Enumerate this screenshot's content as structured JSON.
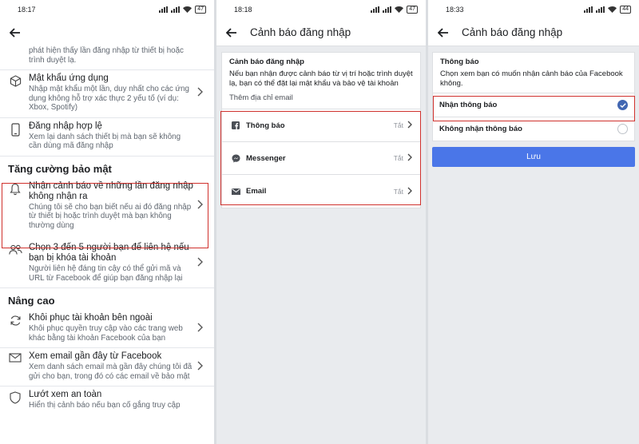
{
  "panel1": {
    "status": {
      "time": "18:17",
      "battery": "47"
    },
    "items_top": [
      {
        "title": "",
        "desc": "phát hiện thấy lần đăng nhập từ thiết bị hoặc trình duyệt lạ."
      },
      {
        "icon": "cube-icon",
        "title": "Mật khẩu ứng dụng",
        "desc": "Nhập mật khẩu một lần, duy nhất cho các ứng dụng không hỗ trợ xác thực 2 yếu tố (ví dụ: Xbox, Spotify)"
      },
      {
        "icon": "phone-icon",
        "title": "Đăng nhập hợp lệ",
        "desc": "Xem lại danh sách thiết bị mà bạn sẽ không cần dùng mã đăng nhập"
      }
    ],
    "section_security": "Tăng cường bảo mật",
    "items_security": [
      {
        "icon": "bell-icon",
        "title": "Nhận cảnh báo về những lần đăng nhập không nhận ra",
        "desc": "Chúng tôi sẽ cho bạn biết nếu ai đó đăng nhập từ thiết bị hoặc trình duyệt mà bạn không thường dùng"
      },
      {
        "icon": "friends-icon",
        "title": "Chọn 3 đến 5 người bạn để liên hệ nếu bạn bị khóa tài khoản",
        "desc": "Người liên hệ đáng tin cậy có thể gửi mã và URL từ Facebook để giúp bạn đăng nhập lại"
      }
    ],
    "section_advanced": "Nâng cao",
    "items_advanced": [
      {
        "icon": "refresh-icon",
        "title": "Khôi phục tài khoản bên ngoài",
        "desc": "Khôi phục quyền truy cập vào các trang web khác bằng tài khoản Facebook của bạn"
      },
      {
        "icon": "email-icon",
        "title": "Xem email gần đây từ Facebook",
        "desc": "Xem danh sách email mà gần đây chúng tôi đã gửi cho bạn, trong đó có các email về bảo mật"
      },
      {
        "icon": "shield-icon",
        "title": "Lướt xem an toàn",
        "desc": "Hiển thị cảnh báo nếu bạn cố gắng truy cập"
      }
    ]
  },
  "panel2": {
    "status": {
      "time": "18:18",
      "battery": "47"
    },
    "title": "Cảnh báo đăng nhập",
    "card_title": "Cảnh báo đăng nhập",
    "card_desc": "Nếu bạn nhận được cảnh báo từ vị trí hoặc trình duyệt lạ, bạn có thể đặt lại mật khẩu và bảo vệ tài khoản",
    "card_link": "Thêm địa chỉ email",
    "rows": [
      {
        "icon": "facebook-icon",
        "label": "Thông báo",
        "value": "Tắt"
      },
      {
        "icon": "messenger-icon",
        "label": "Messenger",
        "value": "Tắt"
      },
      {
        "icon": "envelope-icon",
        "label": "Email",
        "value": "Tắt"
      }
    ]
  },
  "panel3": {
    "status": {
      "time": "18:33",
      "battery": "44"
    },
    "title": "Cảnh báo đăng nhập",
    "card_title": "Thông báo",
    "card_desc": "Chọn xem bạn có muốn nhận cảnh báo của Facebook không.",
    "options": [
      {
        "label": "Nhận thông báo",
        "selected": true
      },
      {
        "label": "Không nhận thông báo",
        "selected": false
      }
    ],
    "save_label": "Lưu"
  },
  "colors": {
    "accent": "#4267b2",
    "button": "#4a76e8",
    "highlight": "#d0312d"
  }
}
